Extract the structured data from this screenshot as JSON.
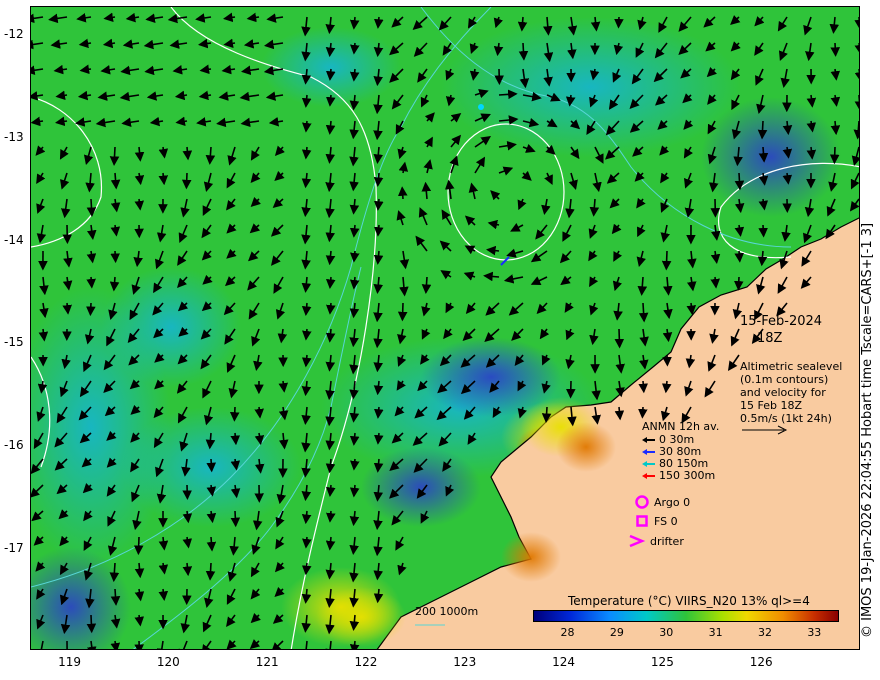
{
  "map": {
    "type": "ocean-temperature-current-map",
    "lon_range": [
      118.6,
      127.0
    ],
    "lat_range": [
      -17.98,
      -11.72
    ],
    "lon_ticks": [
      119,
      120,
      121,
      122,
      123,
      124,
      125,
      126
    ],
    "lon_tick_labels": [
      "119",
      "120",
      "121",
      "122",
      "123",
      "124",
      "125",
      "126"
    ],
    "lat_ticks": [
      -12,
      -13,
      -14,
      -15,
      -16,
      -17
    ],
    "lat_tick_labels": [
      "-12",
      "-13",
      "-14",
      "-15",
      "-16",
      "-17"
    ],
    "colors": {
      "ocean_base": "#2fc43a",
      "land": "#f9cba0",
      "contour_altimetry": "#ffffff",
      "isobath": "#58d6d6",
      "marker": "#ff00ff"
    }
  },
  "date_text": "15-Feb-2024",
  "time_text": "18Z",
  "altimetry_note": [
    "Altimetric sealevel",
    "(0.1m contours)",
    "and velocity for",
    "15 Feb 18Z",
    "0.5m/s (1kt 24h)"
  ],
  "anmn": {
    "title": "ANMN 12h av.",
    "items": [
      {
        "label": "0 30m",
        "color": "#000000"
      },
      {
        "label": "30 80m",
        "color": "#1a2cff"
      },
      {
        "label": "80 150m",
        "color": "#00c8c8"
      },
      {
        "label": "150 300m",
        "color": "#ff0000"
      }
    ]
  },
  "markers": {
    "argo": "Argo 0",
    "fs": "FS 0",
    "drifter": "drifter"
  },
  "depth_legend": "200  1000m",
  "colorbar": {
    "title": "Temperature (°C) VIIRS_N20 13% ql>=4",
    "min": 27.3,
    "max": 33.5,
    "ticks": [
      "28",
      "29",
      "30",
      "31",
      "32",
      "33"
    ],
    "tick_values": [
      28,
      29,
      30,
      31,
      32,
      33
    ]
  },
  "side_text": "© IMOS 19-Jan-2026 22:04:55 Hobart time Tscale=CARS+[-1 3]"
}
